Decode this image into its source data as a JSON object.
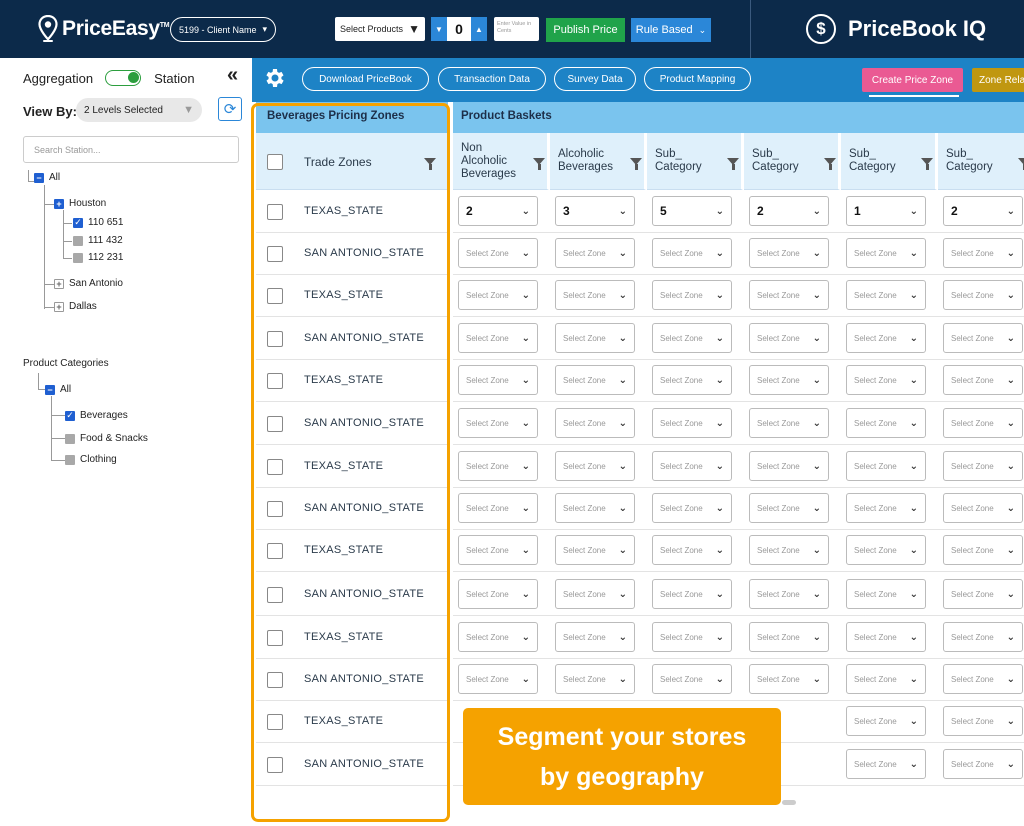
{
  "header": {
    "brand": "PriceEasy",
    "brand_tm": "TM",
    "client": "5199 - Client Name",
    "select_products": "Select Products",
    "stepper_value": "0",
    "cents_placeholder": "Enter Value in Cents",
    "publish_label": "Publish Price",
    "rule_label": "Rule Based",
    "product_name": "PriceBook IQ",
    "colors": {
      "navy": "#0c2a4a",
      "accent": "#2b87d8",
      "green": "#20a34a"
    }
  },
  "sidebar": {
    "aggregation": "Aggregation",
    "station": "Station",
    "viewby_label": "View By:",
    "levels_value": "2 Levels Selected",
    "search_placeholder": "Search Station...",
    "station_tree": {
      "all": "All",
      "houston": "Houston",
      "stations": [
        "110 651",
        "111 432",
        "112 231"
      ],
      "san_antonio": "San Antonio",
      "dallas": "Dallas"
    },
    "categories_title": "Product Categories",
    "categories": {
      "all": "All",
      "items": [
        "Beverages",
        "Food & Snacks",
        "Clothing"
      ]
    }
  },
  "toolbar": {
    "buttons": [
      "Download PriceBook",
      "Transaction Data",
      "Survey Data",
      "Product Mapping"
    ],
    "create_zone": "Create Price Zone",
    "zone_relation": "Zone Relation"
  },
  "table": {
    "zones_title": "Beverages Pricing Zones",
    "baskets_title": "Product Baskets",
    "zone_col": "Trade Zones",
    "basket_cols": [
      "Non Alcoholic Beverages",
      "Alcoholic Beverages",
      "Sub_ Category",
      "Sub_ Category",
      "Sub_ Category",
      "Sub_ Category"
    ],
    "first_row_values": [
      "2",
      "3",
      "5",
      "2",
      "1",
      "2"
    ],
    "zone_rows": [
      "TEXAS_STATE",
      "SAN ANTONIO_STATE",
      "TEXAS_STATE",
      "SAN ANTONIO_STATE",
      "TEXAS_STATE",
      "SAN ANTONIO_STATE",
      "TEXAS_STATE",
      "SAN ANTONIO_STATE",
      "TEXAS_STATE",
      "SAN ANTONIO_STATE",
      "TEXAS_STATE",
      "SAN ANTONIO_STATE",
      "TEXAS_STATE",
      "SAN ANTONIO_STATE"
    ],
    "select_placeholder": "Select Zone"
  },
  "callout": {
    "line1": "Segment your stores",
    "line2": "by geography",
    "color": "#f5a200"
  }
}
